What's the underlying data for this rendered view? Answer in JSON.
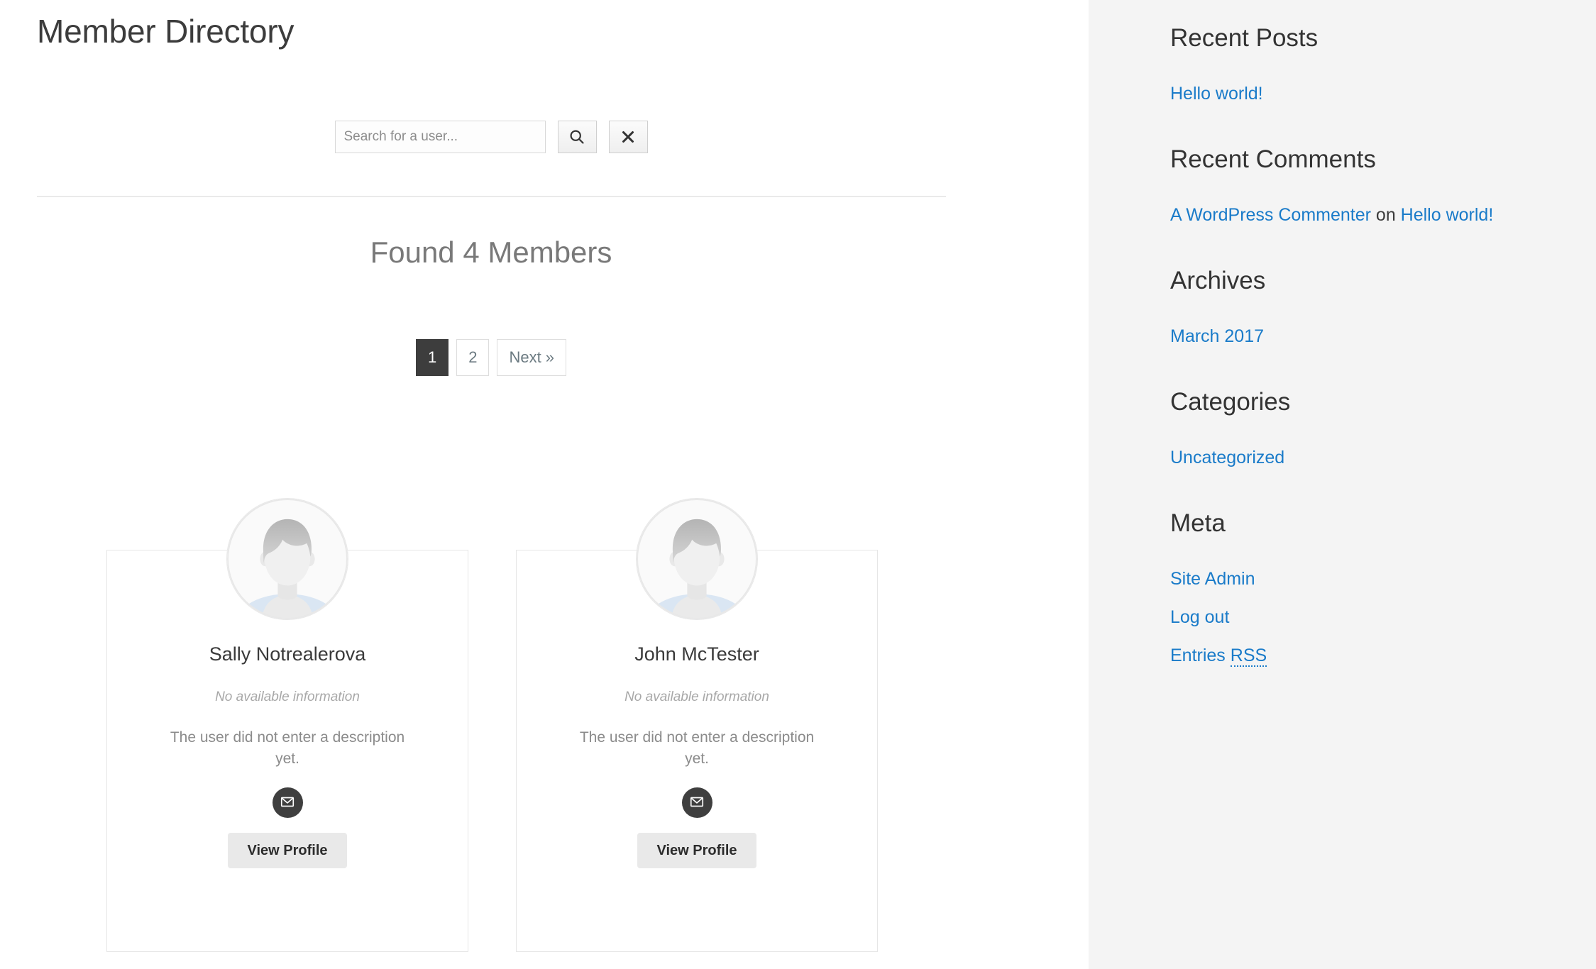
{
  "main": {
    "page_title": "Member Directory",
    "search": {
      "placeholder": "Search for a user...",
      "value": "",
      "search_icon": "search-icon",
      "clear_icon": "close-x-icon"
    },
    "results_heading": "Found 4 Members",
    "pagination": {
      "pages": [
        {
          "label": "1",
          "current": true
        },
        {
          "label": "2",
          "current": false
        },
        {
          "label": "Next »",
          "current": false
        }
      ]
    },
    "members": [
      {
        "name": "Sally Notrealerova",
        "info": "No available information",
        "description": "The user did not enter a description yet.",
        "avatar_icon": "default-avatar-placeholder",
        "mail_icon": "envelope-icon",
        "profile_button": "View Profile"
      },
      {
        "name": "John McTester",
        "info": "No available information",
        "description": "The user did not enter a description yet.",
        "avatar_icon": "default-avatar-placeholder",
        "mail_icon": "envelope-icon",
        "profile_button": "View Profile"
      }
    ]
  },
  "sidebar": {
    "widgets": [
      {
        "title": "Recent Posts",
        "items": [
          {
            "text": "Hello world!"
          }
        ]
      },
      {
        "title": "Recent Comments",
        "items": [
          {
            "author": "A WordPress Commenter",
            "connector": " on ",
            "post": "Hello world!"
          }
        ]
      },
      {
        "title": "Archives",
        "items": [
          {
            "text": "March 2017"
          }
        ]
      },
      {
        "title": "Categories",
        "items": [
          {
            "text": "Uncategorized"
          }
        ]
      },
      {
        "title": "Meta",
        "items": [
          {
            "text": "Site Admin"
          },
          {
            "text": "Log out"
          },
          {
            "text_prefix": "Entries ",
            "abbr": "RSS"
          }
        ]
      }
    ]
  },
  "colors": {
    "link": "#1a7bc9",
    "sidebar_bg": "#f4f4f4",
    "active_page_bg": "#3d3d3d",
    "mail_btn_bg": "#3f3f3f",
    "view_profile_bg": "#e9e9e9"
  }
}
